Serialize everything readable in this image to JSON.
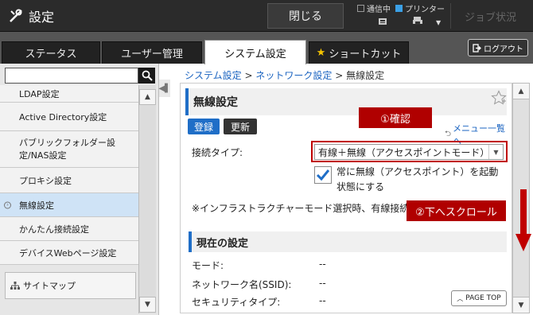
{
  "topbar": {
    "title": "設定",
    "close_label": "閉じる",
    "status_comm": "通信中",
    "status_printer": "プリンター",
    "job_status": "ジョブ状況"
  },
  "tabs": [
    {
      "label": "ステータス"
    },
    {
      "label": "ユーザー管理"
    },
    {
      "label": "システム設定"
    },
    {
      "label": "ショートカット"
    }
  ],
  "logout_label": "ログアウト",
  "sidebar": {
    "search_value": "",
    "items": [
      {
        "label": "LDAP設定"
      },
      {
        "label": "Active Directory設定"
      },
      {
        "label": "パブリックフォルダー設定/NAS設定"
      },
      {
        "label": "プロキシ設定"
      },
      {
        "label": "無線設定"
      },
      {
        "label": "かんたん接続設定"
      },
      {
        "label": "デバイスWebページ設定"
      }
    ],
    "sitemap_label": "サイトマップ"
  },
  "breadcrumb": {
    "level1": "システム設定",
    "level2": "ネットワーク設定",
    "current": "無線設定",
    "sep": ">"
  },
  "main": {
    "section_title": "無線設定",
    "register_label": "登録",
    "update_label": "更新",
    "menu_link": "メニュー一覧へ",
    "connection_type_label": "接続タイプ:",
    "connection_type_value": "有線＋無線（アクセスポイントモード）",
    "checkbox_text": "常に無線（アクセスポイント）を起動状態にする",
    "checkbox_checked": true,
    "note": "※インフラストラクチャーモード選択時、有線接続",
    "current_settings_title": "現在の設定",
    "rows": [
      {
        "label": "モード:",
        "value": "--"
      },
      {
        "label": "ネットワーク名(SSID):",
        "value": "--"
      },
      {
        "label": "セキュリティタイプ:",
        "value": "--"
      }
    ],
    "page_top_label": "PAGE TOP"
  },
  "annotations": {
    "confirm": "①確認",
    "scroll_down": "②下へスクロール",
    "color": "#c00000"
  }
}
